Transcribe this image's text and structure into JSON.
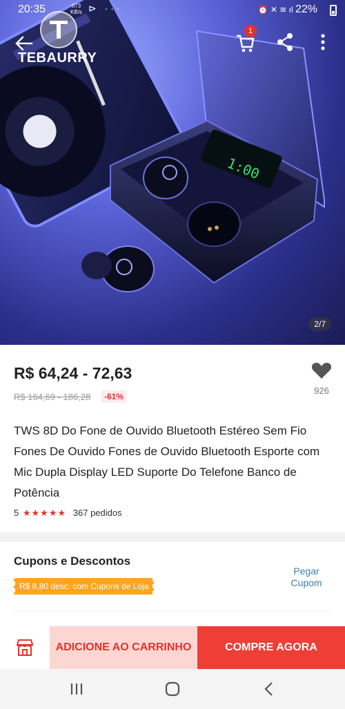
{
  "status_bar": {
    "time": "20:35",
    "speed_value": "673",
    "speed_unit": "KB/s",
    "battery": "22%"
  },
  "header": {
    "brand": "TEBAURRY",
    "cart_count": "1",
    "icons": [
      "back-arrow-icon",
      "cart-icon",
      "share-icon",
      "more-vert-icon"
    ]
  },
  "gallery": {
    "page_indicator": "2/7"
  },
  "product": {
    "price": "R$ 64,24 - 72,63",
    "old_price": "R$ 164,69 - 186,28",
    "discount": "-61%",
    "wishlist_count": "926",
    "title": "TWS 8D Do Fone de Ouvido Bluetooth Estéreo Sem Fio Fones De Ouvido Fones de Ouvido Bluetooth Esporte com Mic Dupla Display LED Suporte Do Telefone Banco de Potência",
    "rating": "5",
    "rating_stars": 5,
    "orders": "367 pedidos"
  },
  "coupons": {
    "heading": "Cupons e Descontos",
    "tag": "R$ 8,80 desc. com Cupons de Loja",
    "action": "Pegar Cupom"
  },
  "actions": {
    "add_to_cart": "ADICIONE AO CARRINHO",
    "buy_now": "COMPRE AGORA"
  },
  "colors": {
    "accent_red": "#ee3e36",
    "accent_pink": "#fdd6d2",
    "coupon_orange": "#ffa41e",
    "link_blue": "#3b7fb0"
  }
}
